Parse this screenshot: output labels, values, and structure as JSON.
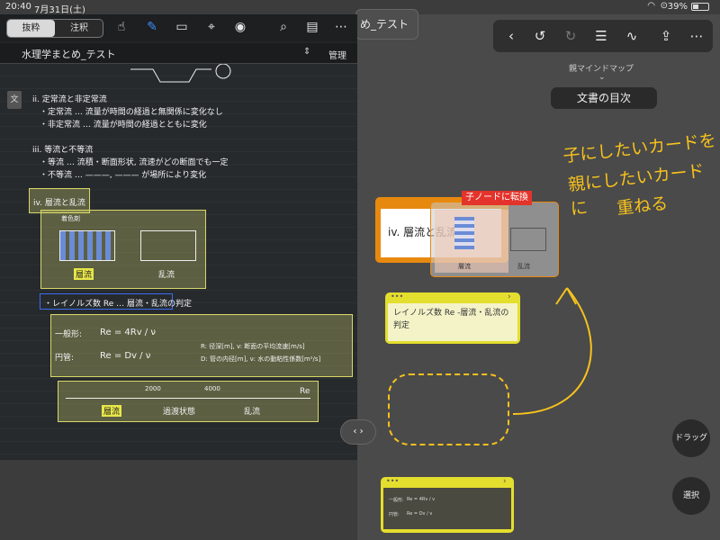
{
  "status": {
    "time": "20:40",
    "date": "7月31日(土)",
    "battery": "39%"
  },
  "toolbar": {
    "seg_excerpt": "抜粋",
    "seg_annotation": "注釈",
    "icons": [
      "hand-icon",
      "pen-icon",
      "rect-select-icon",
      "lasso-icon",
      "camera-icon",
      "search-icon",
      "bookmark-icon",
      "more-icon"
    ]
  },
  "doc": {
    "title": "水理学まとめ_テスト",
    "manage": "管理"
  },
  "note": {
    "ii_head": "ii. 定常流と非定常流",
    "ii_1": "・定常流 … 流量が時間の経過と無関係に変化なし",
    "ii_2": "・非定常流 … 流量が時間の経過とともに変化",
    "iii_head": "iii. 等流と不等流",
    "iii_1": "・等流 … 流積・断面形状, 流速がどの断面でも一定",
    "iii_2": "・不等流 … ———, ——— が場所により変化",
    "iv_head": "iv. 層流と乱流",
    "dye": "着色剤",
    "laminar": "層流",
    "turbulent": "乱流",
    "reynolds": "・レイノルズ数 Re … 層流・乱流の判定",
    "general": "一般形:",
    "pipe": "円管:",
    "re1": "Re = 4Rv / ν",
    "re2": "Re = Dv / ν",
    "legend1": "R: 径深[m], v: 断面の平均流速[m/s]",
    "legend2": "D: 管の内径[m], ν: 水の動粘性係数[m²/s]",
    "n2000": "2000",
    "n4000": "4000",
    "re_axis": "Re",
    "transition": "過渡状態"
  },
  "right": {
    "tab_title": "め_テスト",
    "parent_label": "親マインドマップ",
    "toc": "文書の目次",
    "annotation": [
      "子にしたいカードを",
      "親にしたいカードに",
      "重ねる"
    ],
    "card1_title": "iv. 層流と乱流",
    "convert_label": "子ノードに転換",
    "card2_text": "レイノルズ数 Re -層流・乱流の判定",
    "drag_button": "ドラッグ",
    "select_button": "選択",
    "colors": {
      "accent_yellow": "#f7c21c",
      "card_yellow": "#e4de2e",
      "card_orange": "#e8890f",
      "convert_red": "#e4332b"
    }
  }
}
